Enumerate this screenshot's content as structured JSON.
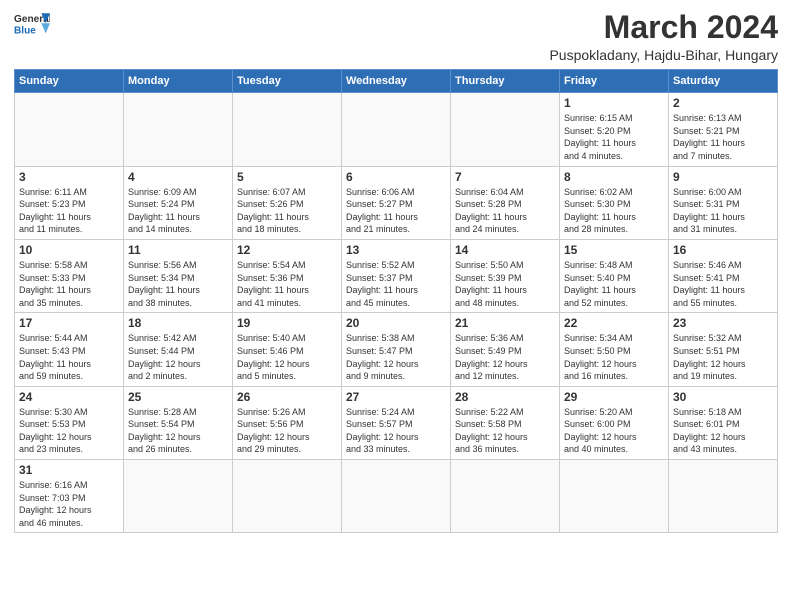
{
  "header": {
    "logo_general": "General",
    "logo_blue": "Blue",
    "month_year": "March 2024",
    "location": "Puspokladany, Hajdu-Bihar, Hungary"
  },
  "days_of_week": [
    "Sunday",
    "Monday",
    "Tuesday",
    "Wednesday",
    "Thursday",
    "Friday",
    "Saturday"
  ],
  "weeks": [
    [
      {
        "day": "",
        "info": ""
      },
      {
        "day": "",
        "info": ""
      },
      {
        "day": "",
        "info": ""
      },
      {
        "day": "",
        "info": ""
      },
      {
        "day": "",
        "info": ""
      },
      {
        "day": "1",
        "info": "Sunrise: 6:15 AM\nSunset: 5:20 PM\nDaylight: 11 hours\nand 4 minutes."
      },
      {
        "day": "2",
        "info": "Sunrise: 6:13 AM\nSunset: 5:21 PM\nDaylight: 11 hours\nand 7 minutes."
      }
    ],
    [
      {
        "day": "3",
        "info": "Sunrise: 6:11 AM\nSunset: 5:23 PM\nDaylight: 11 hours\nand 11 minutes."
      },
      {
        "day": "4",
        "info": "Sunrise: 6:09 AM\nSunset: 5:24 PM\nDaylight: 11 hours\nand 14 minutes."
      },
      {
        "day": "5",
        "info": "Sunrise: 6:07 AM\nSunset: 5:26 PM\nDaylight: 11 hours\nand 18 minutes."
      },
      {
        "day": "6",
        "info": "Sunrise: 6:06 AM\nSunset: 5:27 PM\nDaylight: 11 hours\nand 21 minutes."
      },
      {
        "day": "7",
        "info": "Sunrise: 6:04 AM\nSunset: 5:28 PM\nDaylight: 11 hours\nand 24 minutes."
      },
      {
        "day": "8",
        "info": "Sunrise: 6:02 AM\nSunset: 5:30 PM\nDaylight: 11 hours\nand 28 minutes."
      },
      {
        "day": "9",
        "info": "Sunrise: 6:00 AM\nSunset: 5:31 PM\nDaylight: 11 hours\nand 31 minutes."
      }
    ],
    [
      {
        "day": "10",
        "info": "Sunrise: 5:58 AM\nSunset: 5:33 PM\nDaylight: 11 hours\nand 35 minutes."
      },
      {
        "day": "11",
        "info": "Sunrise: 5:56 AM\nSunset: 5:34 PM\nDaylight: 11 hours\nand 38 minutes."
      },
      {
        "day": "12",
        "info": "Sunrise: 5:54 AM\nSunset: 5:36 PM\nDaylight: 11 hours\nand 41 minutes."
      },
      {
        "day": "13",
        "info": "Sunrise: 5:52 AM\nSunset: 5:37 PM\nDaylight: 11 hours\nand 45 minutes."
      },
      {
        "day": "14",
        "info": "Sunrise: 5:50 AM\nSunset: 5:39 PM\nDaylight: 11 hours\nand 48 minutes."
      },
      {
        "day": "15",
        "info": "Sunrise: 5:48 AM\nSunset: 5:40 PM\nDaylight: 11 hours\nand 52 minutes."
      },
      {
        "day": "16",
        "info": "Sunrise: 5:46 AM\nSunset: 5:41 PM\nDaylight: 11 hours\nand 55 minutes."
      }
    ],
    [
      {
        "day": "17",
        "info": "Sunrise: 5:44 AM\nSunset: 5:43 PM\nDaylight: 11 hours\nand 59 minutes."
      },
      {
        "day": "18",
        "info": "Sunrise: 5:42 AM\nSunset: 5:44 PM\nDaylight: 12 hours\nand 2 minutes."
      },
      {
        "day": "19",
        "info": "Sunrise: 5:40 AM\nSunset: 5:46 PM\nDaylight: 12 hours\nand 5 minutes."
      },
      {
        "day": "20",
        "info": "Sunrise: 5:38 AM\nSunset: 5:47 PM\nDaylight: 12 hours\nand 9 minutes."
      },
      {
        "day": "21",
        "info": "Sunrise: 5:36 AM\nSunset: 5:49 PM\nDaylight: 12 hours\nand 12 minutes."
      },
      {
        "day": "22",
        "info": "Sunrise: 5:34 AM\nSunset: 5:50 PM\nDaylight: 12 hours\nand 16 minutes."
      },
      {
        "day": "23",
        "info": "Sunrise: 5:32 AM\nSunset: 5:51 PM\nDaylight: 12 hours\nand 19 minutes."
      }
    ],
    [
      {
        "day": "24",
        "info": "Sunrise: 5:30 AM\nSunset: 5:53 PM\nDaylight: 12 hours\nand 23 minutes."
      },
      {
        "day": "25",
        "info": "Sunrise: 5:28 AM\nSunset: 5:54 PM\nDaylight: 12 hours\nand 26 minutes."
      },
      {
        "day": "26",
        "info": "Sunrise: 5:26 AM\nSunset: 5:56 PM\nDaylight: 12 hours\nand 29 minutes."
      },
      {
        "day": "27",
        "info": "Sunrise: 5:24 AM\nSunset: 5:57 PM\nDaylight: 12 hours\nand 33 minutes."
      },
      {
        "day": "28",
        "info": "Sunrise: 5:22 AM\nSunset: 5:58 PM\nDaylight: 12 hours\nand 36 minutes."
      },
      {
        "day": "29",
        "info": "Sunrise: 5:20 AM\nSunset: 6:00 PM\nDaylight: 12 hours\nand 40 minutes."
      },
      {
        "day": "30",
        "info": "Sunrise: 5:18 AM\nSunset: 6:01 PM\nDaylight: 12 hours\nand 43 minutes."
      }
    ],
    [
      {
        "day": "31",
        "info": "Sunrise: 6:16 AM\nSunset: 7:03 PM\nDaylight: 12 hours\nand 46 minutes."
      },
      {
        "day": "",
        "info": ""
      },
      {
        "day": "",
        "info": ""
      },
      {
        "day": "",
        "info": ""
      },
      {
        "day": "",
        "info": ""
      },
      {
        "day": "",
        "info": ""
      },
      {
        "day": "",
        "info": ""
      }
    ]
  ]
}
